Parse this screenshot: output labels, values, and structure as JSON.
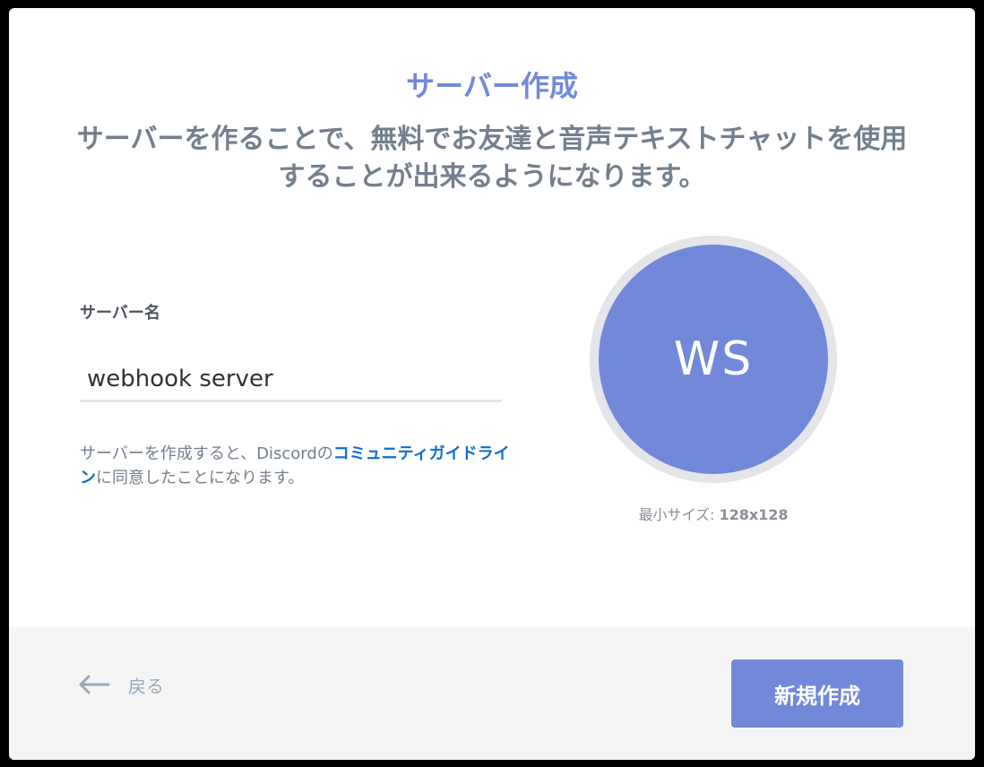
{
  "modal": {
    "title": "サーバー作成",
    "subtitle": "サーバーを作ることで、無料でお友達と音声テキストチャットを使用することが出来るようになります。"
  },
  "form": {
    "server_name_label": "サーバー名",
    "server_name_value": "webhook server",
    "guideline_prefix": "サーバーを作成すると、Discordの",
    "guideline_link": "コミュニティガイドライン",
    "guideline_suffix": "に同意したことになります。"
  },
  "avatar": {
    "initials": "WS",
    "min_size_label": "最小サイズ: ",
    "min_size_value": "128x128"
  },
  "footer": {
    "back_label": "戻る",
    "back_icon": "arrow-left-icon",
    "create_label": "新規作成"
  },
  "colors": {
    "accent": "#7289da",
    "link": "#0b6ecf",
    "muted": "#747f8d",
    "footer_bg": "#f5f5f6"
  }
}
